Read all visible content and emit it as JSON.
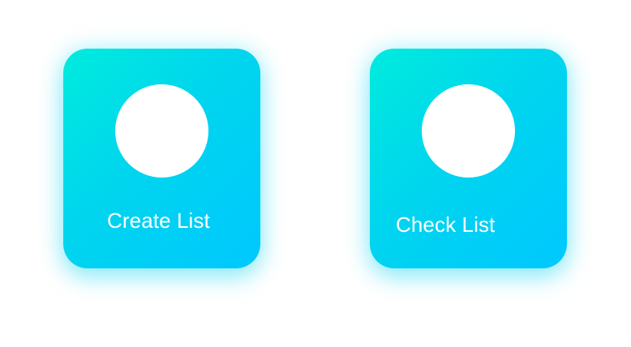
{
  "cards": [
    {
      "label": "Create List"
    },
    {
      "label": "Check List"
    }
  ],
  "colors": {
    "gradient_start": "#00ebdd",
    "gradient_end": "#00c8ff",
    "text": "#ffffff",
    "background": "#ffffff"
  }
}
